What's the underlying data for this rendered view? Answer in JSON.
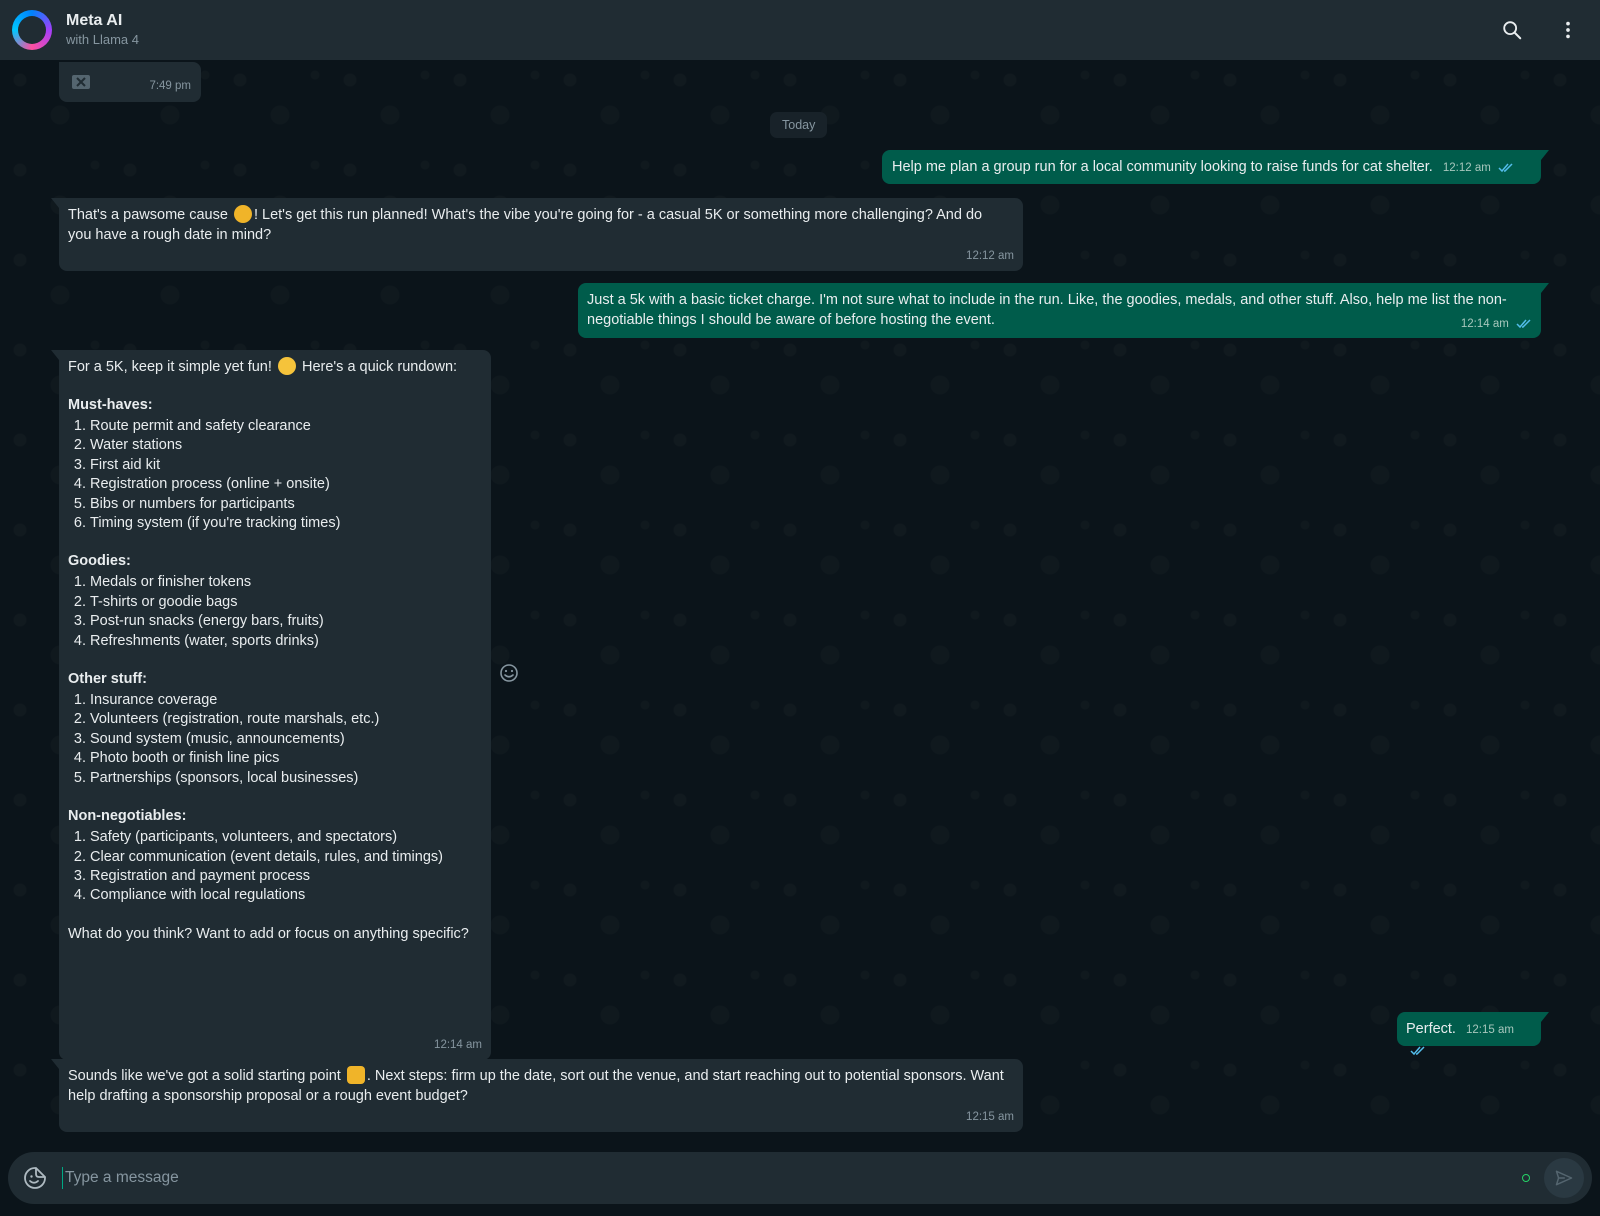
{
  "header": {
    "title": "Meta AI",
    "subtitle": "with Llama 4",
    "search_icon": "search-icon",
    "menu_icon": "more-vertical-icon"
  },
  "chat": {
    "prev_message": {
      "time": "7:49 pm",
      "icon": "image-deleted-icon"
    },
    "date_divider": "Today",
    "messages": [
      {
        "role": "user",
        "text": "Help me plan a group run for a local community looking to raise funds for cat shelter.",
        "time": "12:12 am"
      },
      {
        "role": "assistant",
        "text_before_emoji": "That's a pawsome cause ",
        "emoji": "cat-emoji",
        "text_after_emoji": "! Let's get this run planned! What's the vibe you're going for - a casual 5K or something more challenging? And do you have a rough date in mind?",
        "time": "12:12 am"
      },
      {
        "role": "user",
        "text": "Just a 5k with a basic ticket charge. I'm not sure what to include in the run. Like, the goodies, medals, and other stuff. Also, help me list the non-negotiable things I should be aware of before hosting the event.",
        "time": "12:14 am"
      },
      {
        "role": "assistant",
        "intro_before_emoji": "For a 5K, keep it simple yet fun! ",
        "intro_emoji": "smiling-emoji",
        "intro_after_emoji": " Here's a quick rundown:",
        "sections": [
          {
            "title": "Must-haves:",
            "items": [
              "Route permit and safety clearance",
              "Water stations",
              "First aid kit",
              "Registration process (online + onsite)",
              "Bibs or numbers for participants",
              "Timing system (if you're tracking times)"
            ]
          },
          {
            "title": "Goodies:",
            "items": [
              "Medals or finisher tokens",
              "T-shirts or goodie bags",
              "Post-run snacks (energy bars, fruits)",
              "Refreshments (water, sports drinks)"
            ]
          },
          {
            "title": "Other stuff:",
            "items": [
              "Insurance coverage",
              "Volunteers (registration, route marshals, etc.)",
              "Sound system (music, announcements)",
              "Photo booth or finish line pics",
              "Partnerships (sponsors, local businesses)"
            ]
          },
          {
            "title": "Non-negotiables:",
            "items": [
              "Safety (participants, volunteers, and spectators)",
              "Clear communication (event details, rules, and timings)",
              "Registration and payment process",
              "Compliance with local regulations"
            ]
          }
        ],
        "outro": "What do you think? Want to add or focus on anything specific?",
        "time": "12:14 am"
      },
      {
        "role": "user",
        "text": "Perfect.",
        "time": "12:15 am"
      },
      {
        "role": "assistant",
        "text_before_emoji": "Sounds like we've got a solid starting point ",
        "emoji": "thumbs-up-emoji",
        "text_after_emoji": ". Next steps: firm up the date, sort out the venue, and start reaching out to potential sponsors. Want help drafting a sponsorship proposal or a rough event budget?",
        "time": "12:15 am"
      }
    ],
    "react_icon": "smiley-icon"
  },
  "composer": {
    "placeholder": "Type a message",
    "sticker_icon": "sticker-icon",
    "send_icon": "send-icon"
  },
  "colors": {
    "background": "#0b141a",
    "header": "#202c33",
    "incoming_bubble": "#202c33",
    "outgoing_bubble": "#005c4b",
    "read_ticks": "#53bdeb"
  }
}
